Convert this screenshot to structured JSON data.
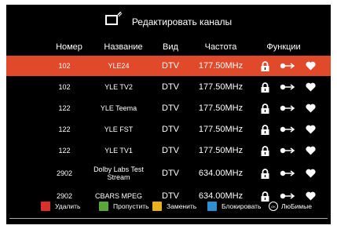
{
  "header": {
    "title": "Редактировать каналы",
    "icon": "tv-edit-icon"
  },
  "columns": {
    "number": "Номер",
    "name": "Название",
    "type": "Вид",
    "frequency": "Частота",
    "functions": "Функции"
  },
  "rows": [
    {
      "number": "102",
      "name": "YLE24",
      "type": "DTV",
      "frequency": "177.50MHz",
      "selected": true
    },
    {
      "number": "102",
      "name": "YLE TV2",
      "type": "DTV",
      "frequency": "177.50MHz"
    },
    {
      "number": "122",
      "name": "YLE Teema",
      "type": "DTV",
      "frequency": "177.50MHz"
    },
    {
      "number": "122",
      "name": "YLE FST",
      "type": "DTV",
      "frequency": "177.50MHz"
    },
    {
      "number": "122",
      "name": "YLE TV1",
      "type": "DTV",
      "frequency": "177.50MHz"
    },
    {
      "number": "2902",
      "name": "Dolby Labs Test Stream",
      "type": "DTV",
      "frequency": "634.00MHz"
    },
    {
      "number": "2902",
      "name": "CBARS MPEG",
      "type": "DTV",
      "frequency": "634.00MHz"
    }
  ],
  "footer": {
    "delete": {
      "label": "Удалить",
      "color": "#d8302a"
    },
    "skip": {
      "label": "Пропустить",
      "color": "#5aa83a"
    },
    "replace": {
      "label": "Заменить",
      "color": "#e8b21f"
    },
    "block": {
      "label": "Блокировать",
      "color": "#2f8fd0"
    },
    "favorites": {
      "label": "ЛюБимые",
      "ok": "OK"
    }
  },
  "colors": {
    "selected_row": "#e0492a",
    "background": "#000000"
  }
}
